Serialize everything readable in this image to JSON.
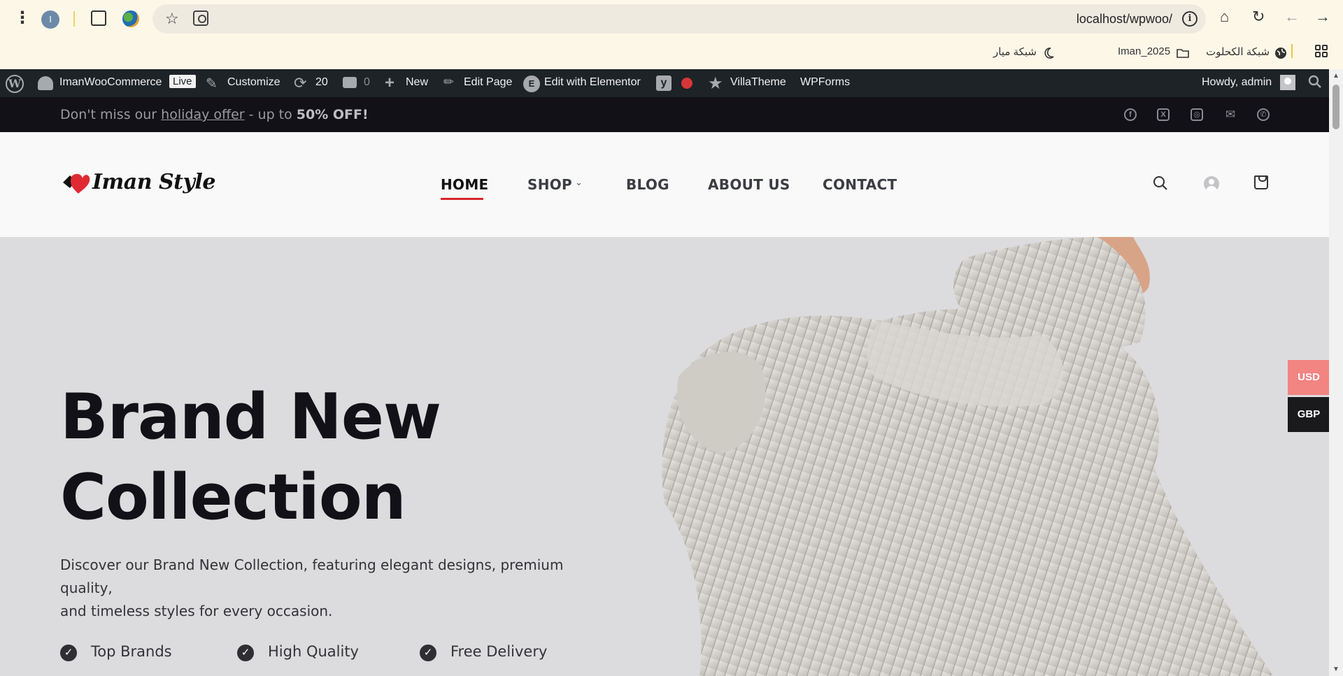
{
  "browser": {
    "profile_initial": "I",
    "url": "localhost/wpwoo/",
    "bookmarks": [
      {
        "label": "شبكة الكحلوت",
        "icon": "globe-icon"
      },
      {
        "label": "Iman_2025",
        "icon": "folder-icon"
      },
      {
        "label": "شبكة ميار",
        "icon": "moon-icon"
      }
    ]
  },
  "admin_bar": {
    "site_name": "ImanWooCommerce",
    "live_badge": "Live",
    "customize": "Customize",
    "updates_count": "20",
    "comments_count": "0",
    "new": "New",
    "edit_page": "Edit Page",
    "edit_elementor": "Edit with Elementor",
    "villatheme": "VillaTheme",
    "wpforms": "WPForms",
    "howdy": "Howdy, admin"
  },
  "topbar": {
    "prefix": "Don't miss our ",
    "link": "holiday offer",
    "middle": " - up to ",
    "highlight": "50% OFF!",
    "social": [
      "facebook-icon",
      "x-icon",
      "instagram-icon",
      "email-icon",
      "phone-icon"
    ]
  },
  "header": {
    "logo_text": "Iman Style",
    "nav": [
      "HOME",
      "SHOP",
      "BLOG",
      "ABOUT US",
      "CONTACT"
    ]
  },
  "hero": {
    "title_line1": "Brand New",
    "title_line2": "Collection",
    "description_line1": "Discover our Brand New Collection, featuring elegant designs, premium quality,",
    "description_line2": "and timeless styles for every occasion.",
    "features": [
      "Top Brands",
      "High Quality",
      "Free Delivery"
    ]
  },
  "currency": {
    "options": [
      "USD",
      "GBP"
    ],
    "selected": "USD",
    "colors": {
      "usd": "#f28482",
      "gbp": "#1a1a1d"
    }
  },
  "colors": {
    "accent": "#d8262d",
    "admin_bar": "#1d2327",
    "topbar": "#121117",
    "hero_bg": "#dcdcde"
  }
}
